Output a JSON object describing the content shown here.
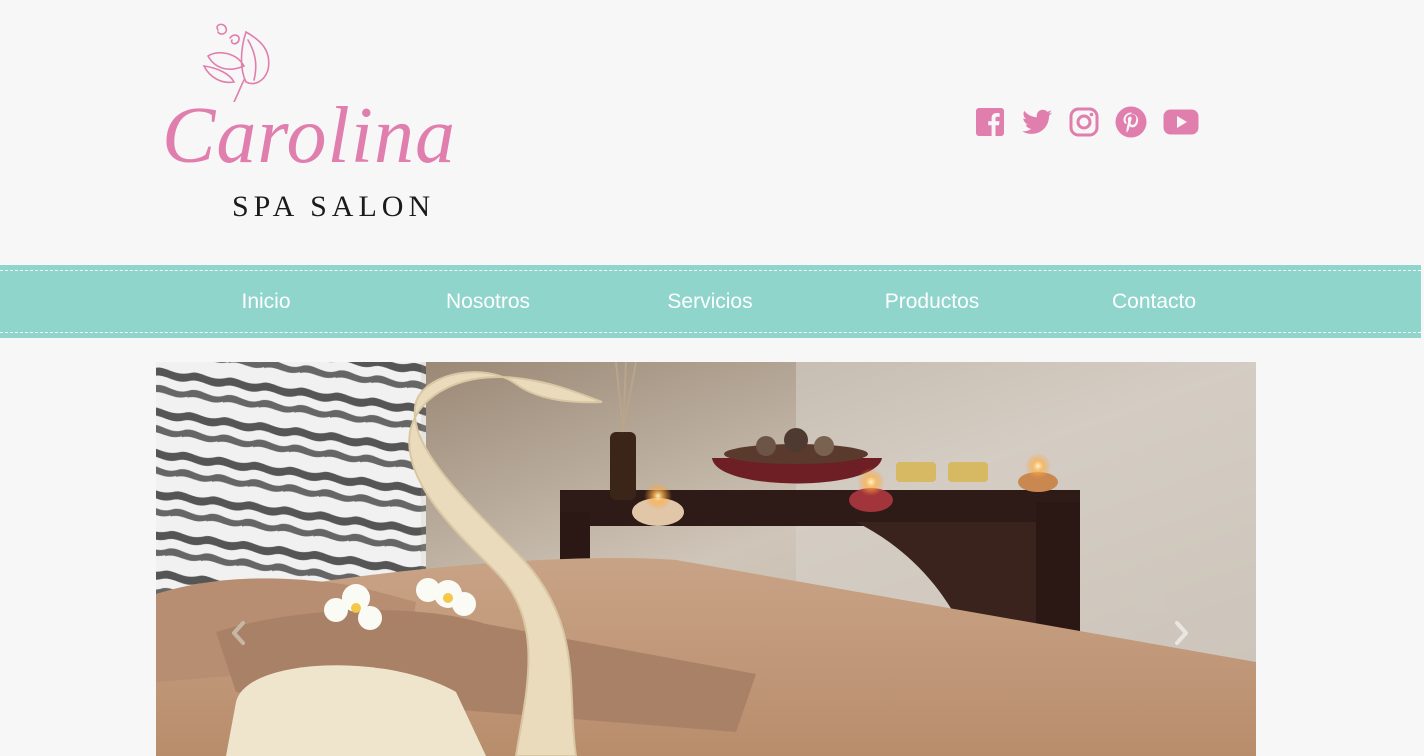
{
  "brand": {
    "script_name": "Carolina",
    "subtitle": "SPA SALON",
    "accent_color": "#e07fae"
  },
  "social": [
    {
      "name": "facebook-icon"
    },
    {
      "name": "twitter-icon"
    },
    {
      "name": "instagram-icon"
    },
    {
      "name": "pinterest-icon"
    },
    {
      "name": "youtube-icon"
    }
  ],
  "nav": {
    "background": "#8fd5cc",
    "items": [
      {
        "label": "Inicio"
      },
      {
        "label": "Nosotros"
      },
      {
        "label": "Servicios"
      },
      {
        "label": "Productos"
      },
      {
        "label": "Contacto"
      }
    ]
  },
  "slider": {
    "prev_icon": "chevron-left-icon",
    "next_icon": "chevron-right-icon"
  }
}
